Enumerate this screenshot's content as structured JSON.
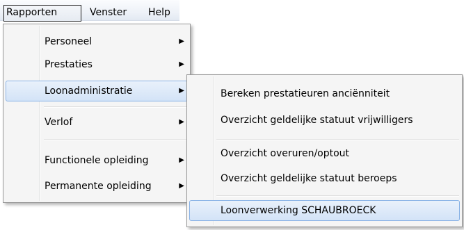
{
  "menubar": {
    "items": [
      {
        "label": "Rapporten"
      },
      {
        "label": "Venster"
      },
      {
        "label": "Help"
      }
    ]
  },
  "rapporten_menu": {
    "items": [
      {
        "label": "Personeel",
        "arrow": "▶"
      },
      {
        "label": "Prestaties",
        "arrow": "▶"
      },
      {
        "label": "Loonadministratie",
        "arrow": "▶"
      },
      {
        "label": "Verlof",
        "arrow": "▶"
      },
      {
        "label": "Functionele opleiding",
        "arrow": "▶"
      },
      {
        "label": "Permanente opleiding",
        "arrow": "▶"
      }
    ],
    "highlighted_item": "Loonadministratie"
  },
  "loonadministratie_menu": {
    "items": [
      {
        "label": "Bereken prestatieuren anciënniteit"
      },
      {
        "label": "Overzicht geldelijke statuut vrijwilligers"
      },
      {
        "label": "Overzicht overuren/optout"
      },
      {
        "label": "Overzicht geldelijke statuut beroeps"
      },
      {
        "label": "Loonverwerking SCHAUBROECK"
      }
    ],
    "highlighted_item": "Loonverwerking SCHAUBROECK"
  },
  "colors": {
    "highlight_fill": "#d3e3f7",
    "highlight_border": "#8ab3e6",
    "menu_background": "#f5f5f5",
    "menu_border": "#979797"
  }
}
